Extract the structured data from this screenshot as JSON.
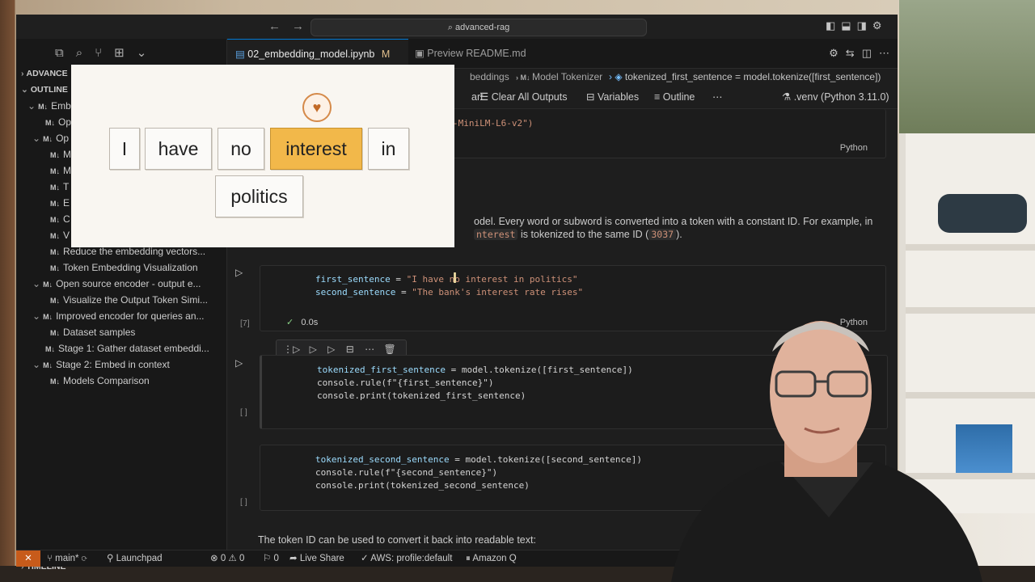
{
  "titlebar": {
    "search_text": "advanced-rag"
  },
  "tabs": [
    {
      "label": "02_embedding_model.ipynb",
      "modifier": "M"
    },
    {
      "label": "Preview README.md"
    }
  ],
  "breadcrumb": {
    "parts": [
      "beddings",
      "Model Tokenizer",
      "tokenized_first_sentence = model.tokenize([first_sentence])"
    ]
  },
  "toolbar": {
    "items": [
      "art",
      "Clear All Outputs",
      "Variables",
      "Outline"
    ],
    "kernel": ".venv (Python 3.11.0)"
  },
  "sidebar": {
    "section_advanced": "ADVANCE",
    "section_outline": "OUTLINE",
    "items": [
      "Emb",
      "Op",
      "Op",
      "M",
      "M",
      "T",
      "E",
      "C",
      "V",
      "Reduce the embedding vectors...",
      "Token Embedding Visualization",
      "Open source encoder - output e...",
      "Visualize the Output Token Simi...",
      "Improved encoder for queries an...",
      "Dataset samples",
      "Stage 1: Gather dataset embeddi...",
      "Stage 2: Embed in context",
      "Models Comparison"
    ],
    "timeline": "TIMELINE"
  },
  "cells": {
    "top_code_fragment": "-MiniLM-L6-v2\")",
    "lang": "Python",
    "markdown_line1": "odel. Every word or subword is converted into a token with a constant ID. For example, in",
    "markdown_code": "nterest",
    "markdown_line2_mid": " is tokenized to the same ID (",
    "markdown_id": "3037",
    "markdown_line2_end": ").",
    "cell7": {
      "number": "[7]",
      "line1_var": "first_sentence",
      "line1_str": "\"I have no interest in politics\"",
      "line2_var": "second_sentence",
      "line2_str": "\"The bank's interest rate rises\"",
      "status": "0.0s"
    },
    "cell8": {
      "number": "[ ]",
      "line1_var": "tokenized_first_sentence",
      "line1_call": "model.tokenize([first_sentence])",
      "line2": "console.rule(f\"{first_sentence}\")",
      "line3": "console.print(tokenized_first_sentence)"
    },
    "cell9": {
      "number": "[ ]",
      "line1_var": "tokenized_second_sentence",
      "line1_call": "model.tokenize([second_sentence])",
      "line2": "console.rule(f\"{second_sentence}\")",
      "line3": "console.print(tokenized_second_sentence)"
    },
    "bottom_markdown": "The token ID can be used to convert it back into readable text:"
  },
  "statusbar": {
    "branch": "main*",
    "launchpad": "Launchpad",
    "problems": "0 ⚠ 0",
    "ports": "0",
    "live_share": "Live Share",
    "aws": "AWS: profile:default",
    "amazon_q": "Amazon Q"
  },
  "overlay": {
    "tokens": [
      "I",
      "have",
      "no",
      "interest",
      "in",
      "politics"
    ],
    "highlighted": "interest",
    "highlight_color": "#f2b84a"
  },
  "colors": {
    "accent": "#0078d4",
    "remote": "#c75b1b"
  }
}
